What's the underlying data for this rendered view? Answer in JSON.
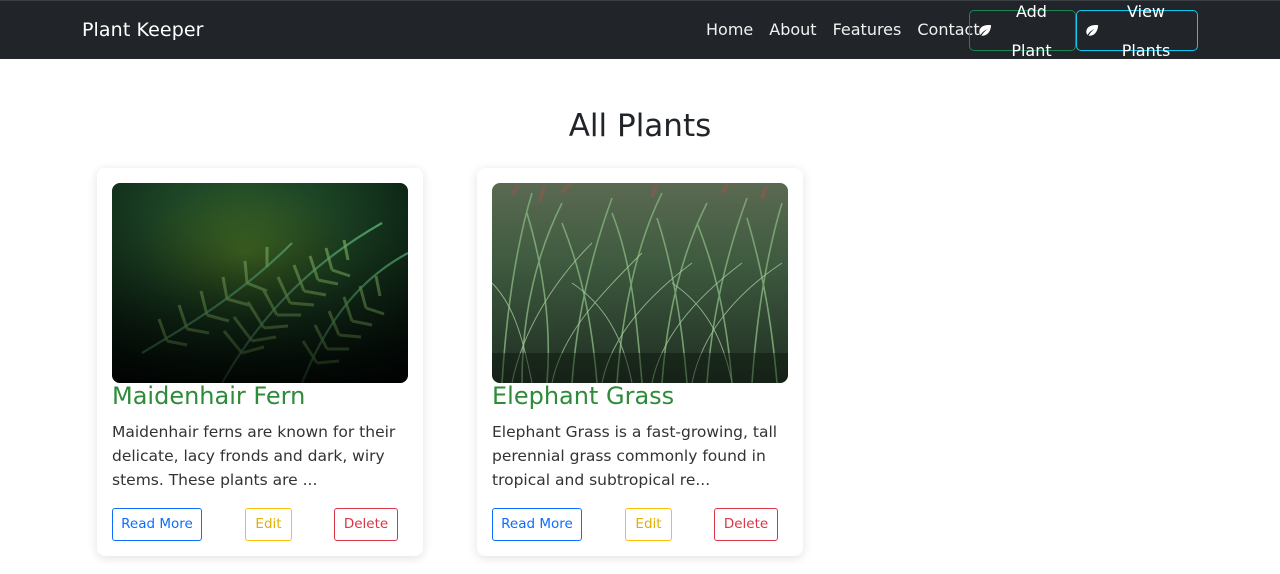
{
  "navbar": {
    "brand": "Plant Keeper",
    "links": [
      "Home",
      "About",
      "Features",
      "Contact"
    ],
    "add_plant": "Add Plant",
    "view_plants": "View Plants",
    "icon": "leaf-icon"
  },
  "page": {
    "title": "All Plants"
  },
  "plants": [
    {
      "name": "Maidenhair Fern",
      "description": "Maidenhair ferns are known for their delicate, lacy fronds and dark, wiry stems. These plants are ...",
      "image": "fern-photo",
      "read_more": "Read More",
      "edit": "Edit",
      "delete": "Delete"
    },
    {
      "name": "Elephant Grass",
      "description": "Elephant Grass is a fast-growing, tall perennial grass commonly found in tropical and subtropical re...",
      "image": "grass-photo",
      "read_more": "Read More",
      "edit": "Edit",
      "delete": "Delete"
    }
  ],
  "colors": {
    "navbar_bg": "#212529",
    "title_green": "#2e8b3a",
    "primary": "#0d6efd",
    "warning": "#ffc107",
    "danger": "#dc3545",
    "success": "#198754",
    "info": "#0dcaf0"
  }
}
